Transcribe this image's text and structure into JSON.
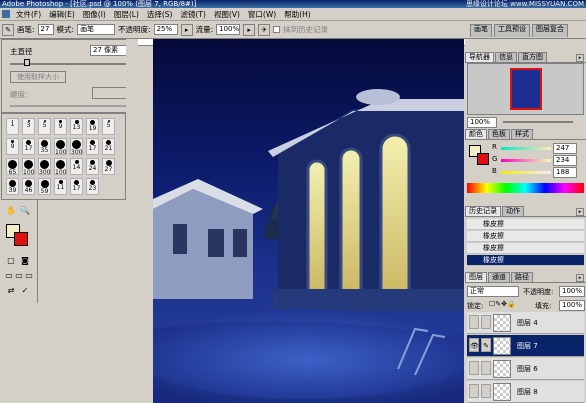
{
  "window": {
    "title": "Adobe Photoshop - [社区.psd @ 100% (图层 7, RGB/8#)]",
    "watermark": "思缘设计论坛 www.MISSYUAN.COM"
  },
  "menu": [
    "文件(F)",
    "编辑(E)",
    "图像(I)",
    "图层(L)",
    "选择(S)",
    "滤镜(T)",
    "视图(V)",
    "窗口(W)",
    "帮助(H)"
  ],
  "options": {
    "brush_label": "画笔:",
    "brush_size": "27",
    "mode_label": "模式:",
    "mode_value": "画笔",
    "opacity_label": "不透明度:",
    "opacity_value": "25%",
    "flow_label": "流量:",
    "flow_value": "100%",
    "history_erase": "抹到历史记录"
  },
  "brush_popup": {
    "diameter_label": "主直径",
    "diameter_value": "27 像素",
    "use_sample_size": "使用取样大小",
    "hardness_label": "硬度:",
    "presets": [
      {
        "size": "1"
      },
      {
        "size": "3"
      },
      {
        "size": "5"
      },
      {
        "size": "9"
      },
      {
        "size": "13"
      },
      {
        "size": "19"
      },
      {
        "size": "5"
      },
      {
        "size": "9"
      },
      {
        "size": "17"
      },
      {
        "size": "35"
      },
      {
        "size": "100"
      },
      {
        "size": "300"
      },
      {
        "size": "17"
      },
      {
        "size": "21"
      },
      {
        "size": "65"
      },
      {
        "size": "100"
      },
      {
        "size": "300"
      },
      {
        "size": "100"
      },
      {
        "size": "14"
      },
      {
        "size": "24"
      },
      {
        "size": "27"
      },
      {
        "size": "39"
      },
      {
        "size": "46"
      },
      {
        "size": "59"
      },
      {
        "size": "11"
      },
      {
        "size": "17"
      },
      {
        "size": "23"
      }
    ]
  },
  "colors": {
    "foreground": "#f5ecc8",
    "background": "#e11010",
    "accent": "#0a246a"
  },
  "navigator": {
    "tabs": [
      "导航器",
      "信息",
      "直方图"
    ],
    "zoom": "100%"
  },
  "color_panel": {
    "tabs": [
      "颜色",
      "色板",
      "样式"
    ],
    "r_label": "R",
    "r_value": "247",
    "g_label": "G",
    "g_value": "234",
    "b_label": "B",
    "b_value": "188"
  },
  "history": {
    "tabs": [
      "历史记录",
      "动作"
    ],
    "items": [
      "橡皮擦",
      "橡皮擦",
      "橡皮擦",
      "橡皮擦"
    ]
  },
  "layers": {
    "tabs": [
      "图层",
      "通道",
      "路径"
    ],
    "blend_mode": "正常",
    "opacity_label": "不透明度:",
    "opacity_value": "100%",
    "lock_label": "锁定:",
    "fill_label": "填充:",
    "fill_value": "100%",
    "items": [
      {
        "name": "图层 4"
      },
      {
        "name": "图层 7"
      },
      {
        "name": "图层 6"
      },
      {
        "name": "图层 8"
      }
    ]
  },
  "top_panel": {
    "tabs": [
      "画笔",
      "工具预设",
      "图层复合"
    ]
  }
}
